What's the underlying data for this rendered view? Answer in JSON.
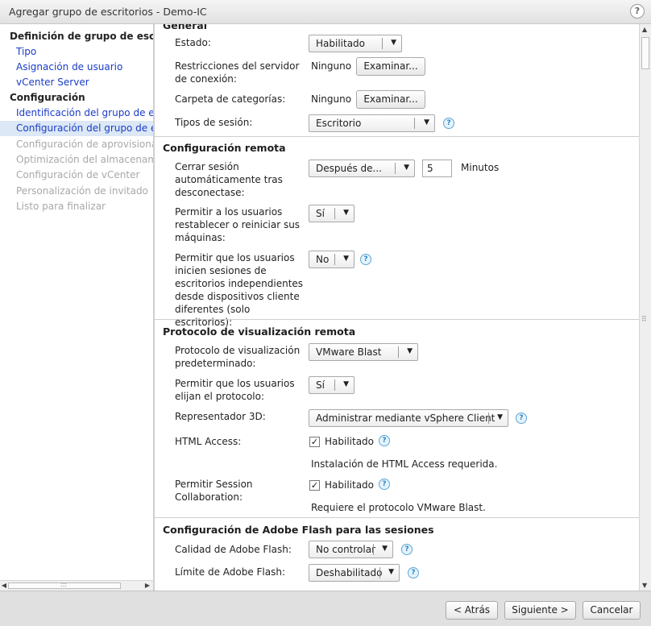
{
  "window": {
    "title": "Agregar grupo de escritorios - Demo-IC",
    "help_icon": "question-icon"
  },
  "nav": [
    {
      "label": "Definición de grupo de escritorios",
      "kind": "section"
    },
    {
      "label": "Tipo",
      "kind": "link"
    },
    {
      "label": "Asignación de usuario",
      "kind": "link"
    },
    {
      "label": "vCenter Server",
      "kind": "link"
    },
    {
      "label": "Configuración",
      "kind": "section"
    },
    {
      "label": "Identificación del grupo de escritorios",
      "kind": "link"
    },
    {
      "label": "Configuración del grupo de escritorios",
      "kind": "selected"
    },
    {
      "label": "Configuración de aprovisionamiento",
      "kind": "disabled"
    },
    {
      "label": "Optimización del almacenamiento",
      "kind": "disabled"
    },
    {
      "label": "Configuración de vCenter",
      "kind": "disabled"
    },
    {
      "label": "Personalización de invitado",
      "kind": "disabled"
    },
    {
      "label": "Listo para finalizar",
      "kind": "disabled"
    }
  ],
  "general": {
    "header": "General",
    "estado_label": "Estado:",
    "estado_value": "Habilitado",
    "restricciones_label": "Restricciones del servidor de conexión:",
    "restricciones_value": "Ninguno",
    "carpeta_label": "Carpeta de categorías:",
    "carpeta_value": "Ninguno",
    "examinar_label": "Examinar...",
    "tipos_label": "Tipos de sesión:",
    "tipos_value": "Escritorio"
  },
  "remote": {
    "header": "Configuración remota",
    "cerrar_label": "Cerrar sesión automáticamente tras desconectase:",
    "cerrar_value": "Después de...",
    "minutes_value": "5",
    "minutes_unit": "Minutos",
    "permitir_label": "Permitir a los usuarios restablecer o reiniciar sus máquinas:",
    "permitir_value": "Sí",
    "independientes_label": "Permitir que los usuarios inicien sesiones de escritorios independientes desde dispositivos cliente diferentes (solo escritorios):",
    "independientes_value": "No"
  },
  "display": {
    "header": "Protocolo de visualización remota",
    "protocolo_label": "Protocolo de visualización predeterminado:",
    "protocolo_value": "VMware Blast",
    "elijan_label": "Permitir que los usuarios elijan el protocolo:",
    "elijan_value": "Sí",
    "render3d_label": "Representador 3D:",
    "render3d_value": "Administrar mediante vSphere Client",
    "html_label": "HTML Access:",
    "html_check_label": "Habilitado",
    "html_note": "Instalación de HTML Access requerida.",
    "collab_label": "Permitir Session Collaboration:",
    "collab_check_label": "Habilitado",
    "collab_note": "Requiere el protocolo VMware Blast."
  },
  "flash": {
    "header": "Configuración de Adobe Flash para las sesiones",
    "calidad_label": "Calidad de Adobe Flash:",
    "calidad_value": "No controlar",
    "limite_label": "Límite de Adobe Flash:",
    "limite_value": "Deshabilitado"
  },
  "footer": {
    "back_label": "< Atrás",
    "next_label": "Siguiente >",
    "cancel_label": "Cancelar"
  }
}
